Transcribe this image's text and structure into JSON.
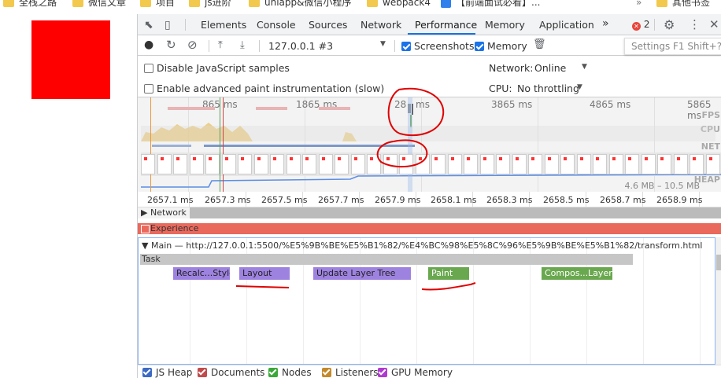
{
  "bookmarks": [
    "全栈之路",
    "微信文章",
    "项目",
    "js进阶",
    "uniapp&微信小程序",
    "webpack4",
    "【前端面试必看】...",
    "其他书签"
  ],
  "devtools": {
    "tabs": [
      "Elements",
      "Console",
      "Sources",
      "Network",
      "Performance",
      "Memory",
      "Application"
    ],
    "active_tab": "Performance",
    "more_tabs": "»",
    "error_count": "2",
    "error_dot": "✕",
    "settings_icon": "gear-icon",
    "menu_icon": "⋮",
    "close_icon": "✕"
  },
  "toolbar": {
    "recording": "127.0.0.1 #3",
    "screenshots_label": "Screenshots",
    "screenshots_checked": true,
    "memory_label": "Memory",
    "memory_checked": true,
    "tooltip": "Settings  F1  Shift+?"
  },
  "settings": {
    "disable_js_samples": "Disable JavaScript samples",
    "advanced_paint": "Enable advanced paint instrumentation (slow)",
    "network_label": "Network:",
    "network_value": "Online",
    "cpu_label": "CPU:",
    "cpu_value": "No throttling"
  },
  "overview": {
    "ticks": [
      "865 ms",
      "1865 ms",
      "28",
      "ms",
      "3865 ms",
      "4865 ms",
      "5865 ms"
    ],
    "labels": [
      "FPS",
      "CPU",
      "NET",
      "HEAP"
    ],
    "heap_range": "4.6 MB – 10.5 MB"
  },
  "ruler": {
    "ticks": [
      "2657.1 ms",
      "2657.3 ms",
      "2657.5 ms",
      "2657.7 ms",
      "2657.9 ms",
      "2658.1 ms",
      "2658.3 ms",
      "2658.5 ms",
      "2658.7 ms",
      "2658.9 ms"
    ]
  },
  "tracks": {
    "network": "Network",
    "experience": "Experience",
    "main": "Main — http://127.0.0.1:5500/%E5%9B%BE%E5%B1%82/%E4%BC%98%E5%8C%96%E5%9B%BE%E5%B1%82/transform.html",
    "task": "Task",
    "events": [
      "Recalc...Style",
      "Layout",
      "Update Layer Tree",
      "Paint",
      "Compos...Layers"
    ]
  },
  "legend": [
    "JS Heap",
    "Documents",
    "Nodes",
    "Listeners",
    "GPU Memory"
  ],
  "colors": {
    "accent": "#1a73e8",
    "experience": "#e9695d",
    "event_purple": "#9e82e0",
    "event_green": "#6aa84f",
    "annotation": "#e00000"
  }
}
